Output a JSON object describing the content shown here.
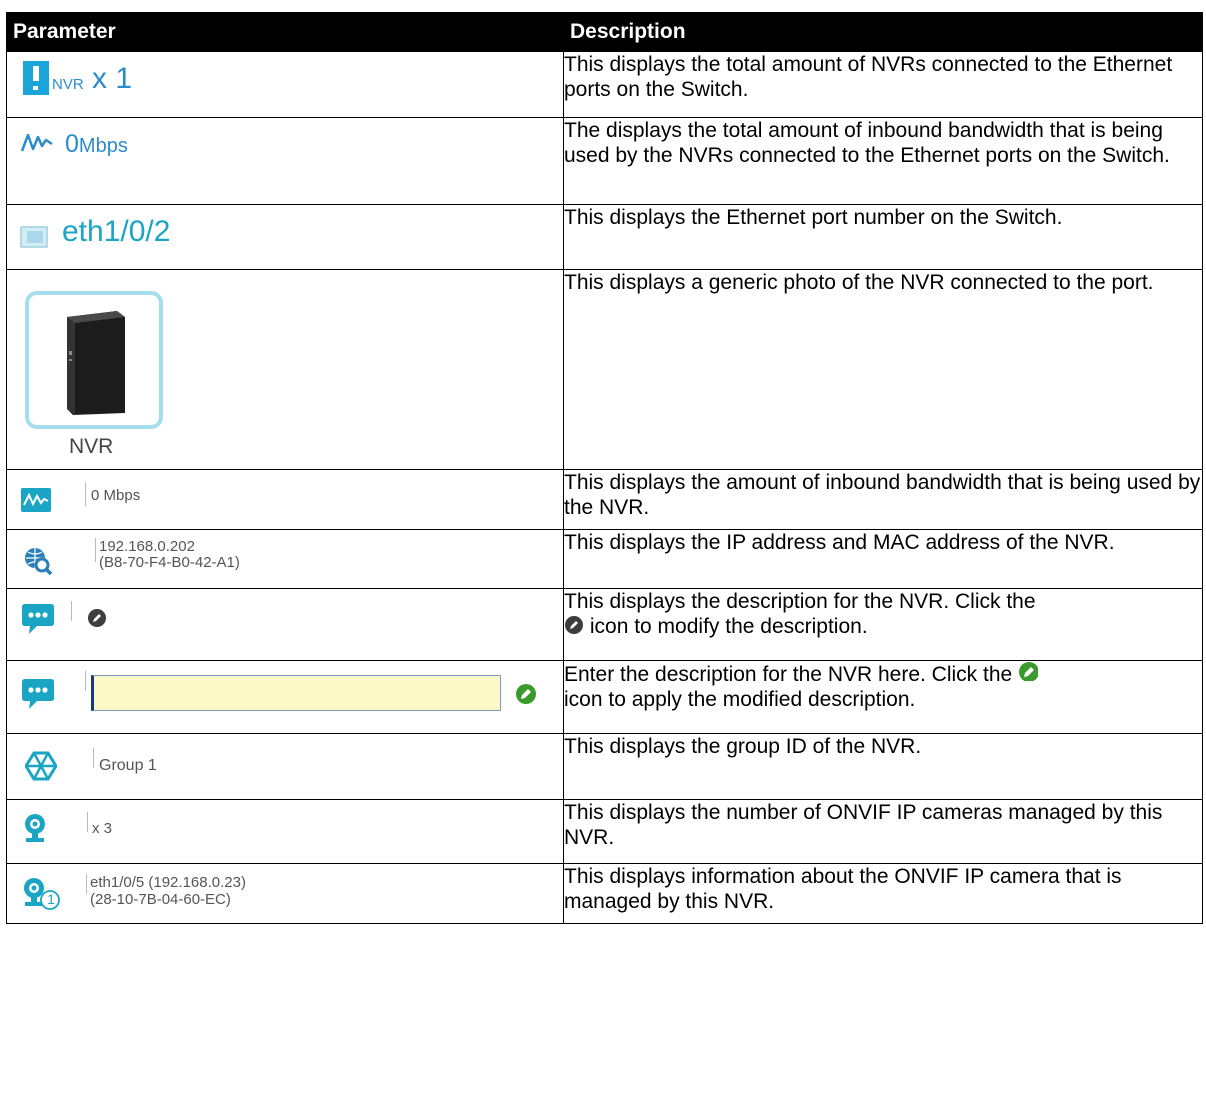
{
  "header": {
    "parameter": "Parameter",
    "description": "Description"
  },
  "rows": [
    {
      "param": {
        "nvr_label": "NVR",
        "count": "x 1"
      },
      "description": "This displays the total amount of NVRs connected to the Ethernet ports on the Switch."
    },
    {
      "param": {
        "value": "0",
        "unit": "Mbps"
      },
      "description": "The displays the total amount of inbound bandwidth that is being used by the NVRs connected to the Ethernet ports on the Switch."
    },
    {
      "param": {
        "port": "eth1/0/2"
      },
      "description": "This displays the Ethernet port number on the Switch."
    },
    {
      "param": {
        "label": "NVR"
      },
      "description": "This displays a generic photo of the NVR connected to the port."
    },
    {
      "param": {
        "value": "0 Mbps"
      },
      "description": "This displays the amount of inbound bandwidth that is being used by the NVR."
    },
    {
      "param": {
        "ip": "192.168.0.202",
        "mac": "(B8-70-F4-B0-42-A1)"
      },
      "description": "This displays the IP address and MAC address of the NVR."
    },
    {
      "param": {},
      "description_before": "This displays the description for the NVR. Click the",
      "description_after": "icon to modify the description."
    },
    {
      "param": {
        "input_value": ""
      },
      "description_before": "Enter the description for the NVR here. Click the",
      "description_after": "icon to apply the modified description."
    },
    {
      "param": {
        "group": "Group 1"
      },
      "description": "This displays the group ID of the NVR."
    },
    {
      "param": {
        "count": "x 3"
      },
      "description": "This displays the number of ONVIF IP cameras managed by this NVR."
    },
    {
      "param": {
        "line1": "eth1/0/5 (192.168.0.23)",
        "line2": "(28-10-7B-04-60-EC)",
        "badge": "1"
      },
      "description": "This displays information about the ONVIF IP camera that is managed by this NVR."
    }
  ],
  "colors": {
    "accent_blue": "#2a8ccd",
    "accent_teal": "#1aa5c5",
    "input_bg": "#fdf8c8",
    "edit_green": "#3a9a2c"
  },
  "icons": [
    "nvr-icon",
    "bandwidth-icon",
    "port-icon",
    "nvr-photo",
    "chat-icon",
    "ip-search-icon",
    "pencil-icon",
    "green-pencil-icon",
    "group-icon",
    "camera-icon",
    "camera-badge-icon"
  ]
}
